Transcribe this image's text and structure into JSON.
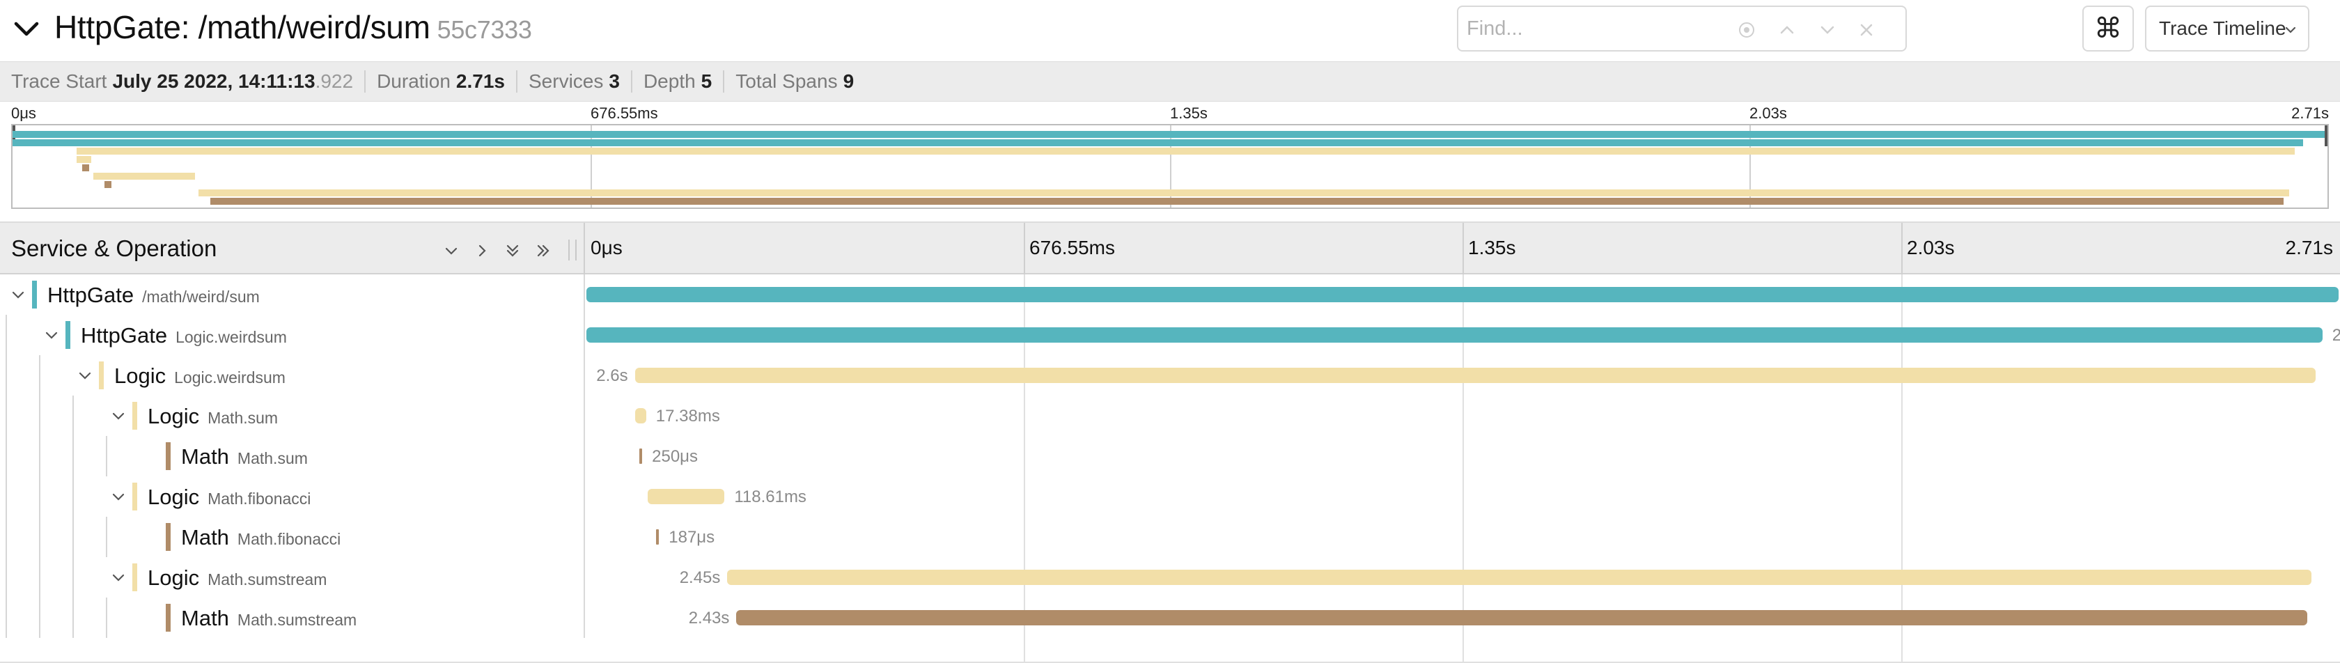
{
  "header": {
    "title": "HttpGate: /math/weird/sum",
    "trace_id": "55c7333",
    "find_placeholder": "Find...",
    "find_value": "",
    "keyboard_shortcut_glyph": "⌘",
    "view_selector_label": "Trace Timeline"
  },
  "summary": {
    "trace_start_label": "Trace Start",
    "trace_start_value": "July 25 2022, 14:11:13",
    "trace_start_ms": ".922",
    "duration_label": "Duration",
    "duration_value": "2.71s",
    "services_label": "Services",
    "services_value": "3",
    "depth_label": "Depth",
    "depth_value": "5",
    "total_spans_label": "Total Spans",
    "total_spans_value": "9"
  },
  "ticks": [
    "0μs",
    "676.55ms",
    "1.35s",
    "2.03s",
    "2.71s"
  ],
  "timeline_header": {
    "title": "Service & Operation"
  },
  "colors": {
    "HttpGate": "#56b5be",
    "Logic": "#f2dfa8",
    "Math": "#b08c68"
  },
  "spans": [
    {
      "service": "HttpGate",
      "operation": "/math/weird/sum",
      "depth": 0,
      "has_children": true,
      "start": 0.0,
      "duration": 2.71,
      "label": ""
    },
    {
      "service": "HttpGate",
      "operation": "Logic.weirdsum",
      "depth": 1,
      "has_children": true,
      "start": 0.0,
      "duration": 2.685,
      "label": "2"
    },
    {
      "service": "Logic",
      "operation": "Logic.weirdsum",
      "depth": 2,
      "has_children": true,
      "start": 0.075,
      "duration": 2.6,
      "label": "2.6s"
    },
    {
      "service": "Logic",
      "operation": "Math.sum",
      "depth": 3,
      "has_children": true,
      "start": 0.075,
      "duration": 0.01738,
      "label": "17.38ms"
    },
    {
      "service": "Math",
      "operation": "Math.sum",
      "depth": 4,
      "has_children": false,
      "start": 0.082,
      "duration": 0.00025,
      "label": "250μs"
    },
    {
      "service": "Logic",
      "operation": "Math.fibonacci",
      "depth": 3,
      "has_children": true,
      "start": 0.095,
      "duration": 0.11861,
      "label": "118.61ms"
    },
    {
      "service": "Math",
      "operation": "Math.fibonacci",
      "depth": 4,
      "has_children": false,
      "start": 0.108,
      "duration": 0.000187,
      "label": "187μs"
    },
    {
      "service": "Logic",
      "operation": "Math.sumstream",
      "depth": 3,
      "has_children": true,
      "start": 0.218,
      "duration": 2.45,
      "label": "2.45s"
    },
    {
      "service": "Math",
      "operation": "Math.sumstream",
      "depth": 4,
      "has_children": false,
      "start": 0.232,
      "duration": 2.43,
      "label": "2.43s"
    }
  ]
}
